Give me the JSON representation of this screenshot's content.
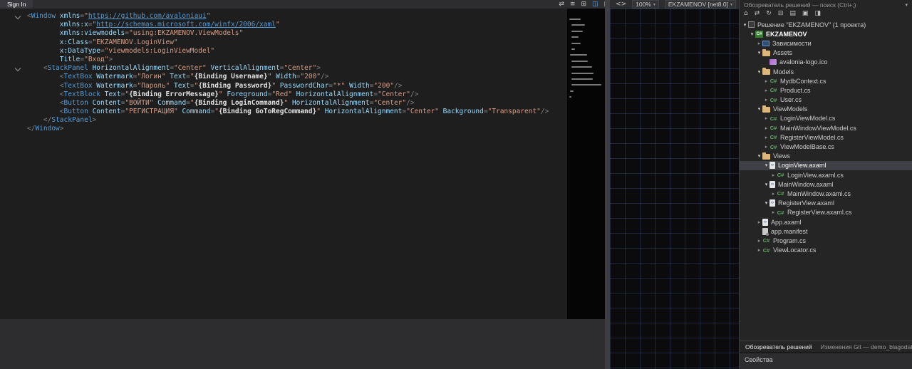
{
  "colors": {
    "editor_bg": "#1e1e1e",
    "panel_bg": "#252526",
    "bar_bg": "#2d2d30",
    "selection_bg": "#3f3f46",
    "tag": "#569cd6",
    "attribute": "#9cdcfe",
    "string": "#d69d85",
    "punctuation": "#808080",
    "folder": "#dcb67a",
    "csharp_green": "#5bb55b"
  },
  "doc_tab": {
    "label": "Sign In"
  },
  "designer_toolbar": {
    "zoom_value": "100%",
    "project_target": "EKZAMENOV [net8.0]",
    "icons": [
      {
        "name": "swap-panes-icon",
        "glyph": "⇄"
      },
      {
        "name": "horizontal-split-icon",
        "glyph": "≡"
      },
      {
        "name": "grid-split-icon",
        "glyph": "⊞"
      },
      {
        "name": "vertical-split-icon",
        "glyph": "◫",
        "active": true
      },
      {
        "name": "popout-icon",
        "glyph": "▣"
      },
      {
        "name": "xaml-view-icon",
        "glyph": "<>"
      }
    ]
  },
  "editor": {
    "lines": [
      {
        "fold": true,
        "s": [
          {
            "t": "<",
            "c": "punc"
          },
          {
            "t": "Window",
            "c": "tag"
          },
          {
            "t": " ",
            "c": "plain"
          },
          {
            "t": "xmlns",
            "c": "attr"
          },
          {
            "t": "=",
            "c": "punc"
          },
          {
            "t": "\"",
            "c": "str"
          },
          {
            "t": "https://github.com/avaloniaui",
            "c": "url"
          },
          {
            "t": "\"",
            "c": "str"
          }
        ]
      },
      {
        "s": [
          {
            "t": "        ",
            "c": "plain"
          },
          {
            "t": "xmlns:x",
            "c": "attr"
          },
          {
            "t": "=",
            "c": "punc"
          },
          {
            "t": "\"",
            "c": "str"
          },
          {
            "t": "http://schemas.microsoft.com/winfx/2006/xaml",
            "c": "url"
          },
          {
            "t": "\"",
            "c": "str"
          }
        ]
      },
      {
        "s": [
          {
            "t": "        ",
            "c": "plain"
          },
          {
            "t": "xmlns:viewmodels",
            "c": "attr"
          },
          {
            "t": "=",
            "c": "punc"
          },
          {
            "t": "\"using:EKZAMENOV.ViewModels\"",
            "c": "str"
          }
        ]
      },
      {
        "s": [
          {
            "t": "        ",
            "c": "plain"
          },
          {
            "t": "x:Class",
            "c": "attr"
          },
          {
            "t": "=",
            "c": "punc"
          },
          {
            "t": "\"EKZAMENOV.LoginView\"",
            "c": "str"
          }
        ]
      },
      {
        "s": [
          {
            "t": "        ",
            "c": "plain"
          },
          {
            "t": "x:DataType",
            "c": "attr"
          },
          {
            "t": "=",
            "c": "punc"
          },
          {
            "t": "\"viewmodels:LoginViewModel\"",
            "c": "str"
          }
        ]
      },
      {
        "s": [
          {
            "t": "        ",
            "c": "plain"
          },
          {
            "t": "Title",
            "c": "attr"
          },
          {
            "t": "=",
            "c": "punc"
          },
          {
            "t": "\"Вход\"",
            "c": "str"
          },
          {
            "t": ">",
            "c": "punc"
          }
        ]
      },
      {
        "fold": true,
        "s": [
          {
            "t": "    ",
            "c": "plain"
          },
          {
            "t": "<",
            "c": "punc"
          },
          {
            "t": "StackPanel",
            "c": "tag"
          },
          {
            "t": " ",
            "c": "plain"
          },
          {
            "t": "HorizontalAlignment",
            "c": "attr"
          },
          {
            "t": "=",
            "c": "punc"
          },
          {
            "t": "\"Center\"",
            "c": "str"
          },
          {
            "t": " ",
            "c": "plain"
          },
          {
            "t": "VerticalAlignment",
            "c": "attr"
          },
          {
            "t": "=",
            "c": "punc"
          },
          {
            "t": "\"Center\"",
            "c": "str"
          },
          {
            "t": ">",
            "c": "punc"
          }
        ]
      },
      {
        "s": [
          {
            "t": "        ",
            "c": "plain"
          },
          {
            "t": "<",
            "c": "punc"
          },
          {
            "t": "TextBox",
            "c": "tag"
          },
          {
            "t": " ",
            "c": "plain"
          },
          {
            "t": "Watermark",
            "c": "attr"
          },
          {
            "t": "=",
            "c": "punc"
          },
          {
            "t": "\"Логин\"",
            "c": "str"
          },
          {
            "t": " ",
            "c": "plain"
          },
          {
            "t": "Text",
            "c": "attr"
          },
          {
            "t": "=",
            "c": "punc"
          },
          {
            "t": "\"",
            "c": "str"
          },
          {
            "t": "{Binding Username}",
            "c": "bind"
          },
          {
            "t": "\"",
            "c": "str"
          },
          {
            "t": " ",
            "c": "plain"
          },
          {
            "t": "Width",
            "c": "attr"
          },
          {
            "t": "=",
            "c": "punc"
          },
          {
            "t": "\"200\"",
            "c": "str"
          },
          {
            "t": "/>",
            "c": "punc"
          }
        ]
      },
      {
        "s": [
          {
            "t": "        ",
            "c": "plain"
          },
          {
            "t": "<",
            "c": "punc"
          },
          {
            "t": "TextBox",
            "c": "tag"
          },
          {
            "t": " ",
            "c": "plain"
          },
          {
            "t": "Watermark",
            "c": "attr"
          },
          {
            "t": "=",
            "c": "punc"
          },
          {
            "t": "\"Пароль\"",
            "c": "str"
          },
          {
            "t": " ",
            "c": "plain"
          },
          {
            "t": "Text",
            "c": "attr"
          },
          {
            "t": "=",
            "c": "punc"
          },
          {
            "t": "\"",
            "c": "str"
          },
          {
            "t": "{Binding Password}",
            "c": "bind"
          },
          {
            "t": "\"",
            "c": "str"
          },
          {
            "t": " ",
            "c": "plain"
          },
          {
            "t": "PasswordChar",
            "c": "attr"
          },
          {
            "t": "=",
            "c": "punc"
          },
          {
            "t": "\"*\"",
            "c": "str"
          },
          {
            "t": " ",
            "c": "plain"
          },
          {
            "t": "Width",
            "c": "attr"
          },
          {
            "t": "=",
            "c": "punc"
          },
          {
            "t": "\"200\"",
            "c": "str"
          },
          {
            "t": "/>",
            "c": "punc"
          }
        ]
      },
      {
        "s": [
          {
            "t": "        ",
            "c": "plain"
          },
          {
            "t": "<",
            "c": "punc"
          },
          {
            "t": "TextBlock",
            "c": "tag"
          },
          {
            "t": " ",
            "c": "plain"
          },
          {
            "t": "Text",
            "c": "attr"
          },
          {
            "t": "=",
            "c": "punc"
          },
          {
            "t": "\"",
            "c": "str"
          },
          {
            "t": "{Binding ErrorMessage}",
            "c": "bind"
          },
          {
            "t": "\"",
            "c": "str"
          },
          {
            "t": " ",
            "c": "plain"
          },
          {
            "t": "Foreground",
            "c": "attr"
          },
          {
            "t": "=",
            "c": "punc"
          },
          {
            "t": "\"Red\"",
            "c": "str"
          },
          {
            "t": " ",
            "c": "plain"
          },
          {
            "t": "HorizontalAlignment",
            "c": "attr"
          },
          {
            "t": "=",
            "c": "punc"
          },
          {
            "t": "\"Center\"",
            "c": "str"
          },
          {
            "t": "/>",
            "c": "punc"
          }
        ]
      },
      {
        "s": [
          {
            "t": "        ",
            "c": "plain"
          },
          {
            "t": "<",
            "c": "punc"
          },
          {
            "t": "Button",
            "c": "tag"
          },
          {
            "t": " ",
            "c": "plain"
          },
          {
            "t": "Content",
            "c": "attr"
          },
          {
            "t": "=",
            "c": "punc"
          },
          {
            "t": "\"ВОЙТИ\"",
            "c": "str"
          },
          {
            "t": " ",
            "c": "plain"
          },
          {
            "t": "Command",
            "c": "attr"
          },
          {
            "t": "=",
            "c": "punc"
          },
          {
            "t": "\"",
            "c": "str"
          },
          {
            "t": "{Binding LoginCommand}",
            "c": "bind"
          },
          {
            "t": "\"",
            "c": "str"
          },
          {
            "t": " ",
            "c": "plain"
          },
          {
            "t": "HorizontalAlignment",
            "c": "attr"
          },
          {
            "t": "=",
            "c": "punc"
          },
          {
            "t": "\"Center\"",
            "c": "str"
          },
          {
            "t": "/>",
            "c": "punc"
          }
        ]
      },
      {
        "s": [
          {
            "t": "        ",
            "c": "plain"
          },
          {
            "t": "<",
            "c": "punc"
          },
          {
            "t": "Button",
            "c": "tag"
          },
          {
            "t": " ",
            "c": "plain"
          },
          {
            "t": "Content",
            "c": "attr"
          },
          {
            "t": "=",
            "c": "punc"
          },
          {
            "t": "\"РЕГИСТРАЦИЯ\"",
            "c": "str"
          },
          {
            "t": " ",
            "c": "plain"
          },
          {
            "t": "Command",
            "c": "attr"
          },
          {
            "t": "=",
            "c": "punc"
          },
          {
            "t": "\"",
            "c": "str"
          },
          {
            "t": "{Binding GoToRegCommand}",
            "c": "bind"
          },
          {
            "t": "\"",
            "c": "str"
          },
          {
            "t": " ",
            "c": "plain"
          },
          {
            "t": "HorizontalAlignment",
            "c": "attr"
          },
          {
            "t": "=",
            "c": "punc"
          },
          {
            "t": "\"Center\"",
            "c": "str"
          },
          {
            "t": " ",
            "c": "plain"
          },
          {
            "t": "Background",
            "c": "attr"
          },
          {
            "t": "=",
            "c": "punc"
          },
          {
            "t": "\"Transparent\"",
            "c": "str"
          },
          {
            "t": "/>",
            "c": "punc"
          }
        ]
      },
      {
        "s": [
          {
            "t": "    ",
            "c": "plain"
          },
          {
            "t": "</",
            "c": "punc"
          },
          {
            "t": "StackPanel",
            "c": "tag"
          },
          {
            "t": ">",
            "c": "punc"
          }
        ]
      },
      {
        "s": [
          {
            "t": "</",
            "c": "punc"
          },
          {
            "t": "Window",
            "c": "tag"
          },
          {
            "t": ">",
            "c": "punc"
          }
        ]
      }
    ]
  },
  "solution_explorer": {
    "header": "Обозреватель решений — поиск (Ctrl+;)",
    "toolbar_icons": [
      {
        "name": "home-icon",
        "glyph": "⌂"
      },
      {
        "name": "switch-views-icon",
        "glyph": "⇄"
      },
      {
        "name": "refresh-icon",
        "glyph": "↻"
      },
      {
        "name": "collapse-all-icon",
        "glyph": "⊟"
      },
      {
        "name": "show-all-files-icon",
        "glyph": "▤"
      },
      {
        "name": "properties-icon",
        "glyph": "▣"
      },
      {
        "name": "preview-selected-icon",
        "glyph": "◨"
      }
    ],
    "tree": [
      {
        "label": "Решение \"EKZAMENOV\" (1 проекта)",
        "level": 0,
        "arrow": "expanded",
        "icon": "solution"
      },
      {
        "label": "EKZAMENOV",
        "level": 1,
        "arrow": "expanded",
        "icon": "project",
        "bold": true
      },
      {
        "label": "Зависимости",
        "level": 2,
        "arrow": "collapsed",
        "icon": "dependencies"
      },
      {
        "label": "Assets",
        "level": 2,
        "arrow": "expanded",
        "icon": "folder"
      },
      {
        "label": "avalonia-logo.ico",
        "level": 3,
        "arrow": "none",
        "icon": "image"
      },
      {
        "label": "Models",
        "level": 2,
        "arrow": "expanded",
        "icon": "folder"
      },
      {
        "label": "MydbContext.cs",
        "level": 3,
        "arrow": "collapsed",
        "icon": "csharp"
      },
      {
        "label": "Product.cs",
        "level": 3,
        "arrow": "collapsed",
        "icon": "csharp"
      },
      {
        "label": "User.cs",
        "level": 3,
        "arrow": "collapsed",
        "icon": "csharp"
      },
      {
        "label": "ViewModels",
        "level": 2,
        "arrow": "expanded",
        "icon": "folder"
      },
      {
        "label": "LoginViewModel.cs",
        "level": 3,
        "arrow": "collapsed",
        "icon": "csharp"
      },
      {
        "label": "MainWindowViewModel.cs",
        "level": 3,
        "arrow": "collapsed",
        "icon": "csharp"
      },
      {
        "label": "RegisterViewModel.cs",
        "level": 3,
        "arrow": "collapsed",
        "icon": "csharp"
      },
      {
        "label": "ViewModelBase.cs",
        "level": 3,
        "arrow": "collapsed",
        "icon": "csharp"
      },
      {
        "label": "Views",
        "level": 2,
        "arrow": "expanded",
        "icon": "folder"
      },
      {
        "label": "LoginView.axaml",
        "level": 3,
        "arrow": "expanded",
        "icon": "axaml",
        "selected": true
      },
      {
        "label": "LoginView.axaml.cs",
        "level": 4,
        "arrow": "collapsed",
        "icon": "csharp"
      },
      {
        "label": "MainWindow.axaml",
        "level": 3,
        "arrow": "expanded",
        "icon": "axaml"
      },
      {
        "label": "MainWindow.axaml.cs",
        "level": 4,
        "arrow": "collapsed",
        "icon": "csharp"
      },
      {
        "label": "RegisterView.axaml",
        "level": 3,
        "arrow": "expanded",
        "icon": "axaml"
      },
      {
        "label": "RegisterView.axaml.cs",
        "level": 4,
        "arrow": "collapsed",
        "icon": "csharp"
      },
      {
        "label": "App.axaml",
        "level": 2,
        "arrow": "collapsed",
        "icon": "axaml"
      },
      {
        "label": "app.manifest",
        "level": 2,
        "arrow": "none",
        "icon": "manifest"
      },
      {
        "label": "Program.cs",
        "level": 2,
        "arrow": "collapsed",
        "icon": "csharp"
      },
      {
        "label": "ViewLocator.cs",
        "level": 2,
        "arrow": "collapsed",
        "icon": "csharp"
      }
    ],
    "bottom_tabs": [
      {
        "label": "Обозреватель решений"
      },
      {
        "label": "Изменения Git — demo_blagodat"
      }
    ],
    "properties_label": "Свойства"
  }
}
